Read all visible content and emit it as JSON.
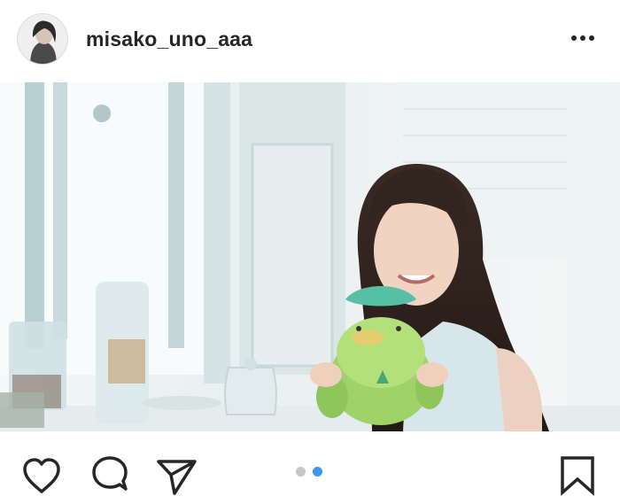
{
  "post": {
    "username": "misako_uno_aaa"
  },
  "carousel": {
    "total": 2,
    "active_index": 1
  },
  "icons": {
    "avatar": "profile-avatar",
    "more": "more-options-icon",
    "like": "heart-icon",
    "comment": "comment-bubble-icon",
    "share": "paper-plane-icon",
    "save": "bookmark-icon"
  },
  "colors": {
    "text": "#262626",
    "dot_active": "#3897f0",
    "dot_inactive": "#c7c7c7",
    "background": "#ffffff"
  }
}
